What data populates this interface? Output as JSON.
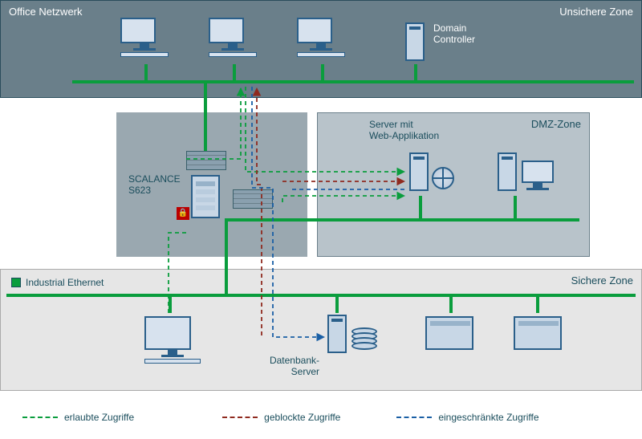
{
  "zones": {
    "unsafe": "Unsichere Zone",
    "office": "Office Netzwerk",
    "dmz": "DMZ-Zone",
    "safe": "Sichere Zone"
  },
  "devices": {
    "domain_controller": "Domain\nController",
    "server_web": "Server mit\nWeb-Applikation",
    "scalance": "SCALANCE\nS623",
    "db_server": "Datenbank-\nServer",
    "industrial_ethernet": "Industrial Ethernet"
  },
  "legend": {
    "allowed": "erlaubte Zugriffe",
    "blocked": "geblockte Zugriffe",
    "restricted": "eingeschränkte Zugriffe"
  },
  "colors": {
    "allowed": "#0a9d3d",
    "blocked": "#8f2a1f",
    "restricted": "#1a5fa5",
    "bus": "#0a9d3d"
  },
  "chart_data": {
    "type": "diagram",
    "nodes": [
      {
        "id": "pc1",
        "type": "pc",
        "zone": "unsafe"
      },
      {
        "id": "pc2",
        "type": "pc",
        "zone": "unsafe"
      },
      {
        "id": "pc3",
        "type": "pc",
        "zone": "unsafe"
      },
      {
        "id": "dc",
        "type": "server",
        "zone": "unsafe",
        "label": "Domain Controller"
      },
      {
        "id": "fw1",
        "type": "firewall",
        "zone": "scalance"
      },
      {
        "id": "fw2",
        "type": "firewall",
        "zone": "scalance"
      },
      {
        "id": "scalance",
        "type": "device",
        "zone": "scalance",
        "label": "SCALANCE S623"
      },
      {
        "id": "webserver",
        "type": "server",
        "zone": "dmz",
        "label": "Server mit Web-Applikation"
      },
      {
        "id": "workstation",
        "type": "workstation",
        "zone": "dmz"
      },
      {
        "id": "pc_safe",
        "type": "pc",
        "zone": "safe"
      },
      {
        "id": "db",
        "type": "server",
        "zone": "safe",
        "label": "Datenbank-Server"
      },
      {
        "id": "plc1",
        "type": "plc",
        "zone": "safe"
      },
      {
        "id": "plc2",
        "type": "plc",
        "zone": "safe"
      }
    ],
    "buses": [
      {
        "zone": "unsafe",
        "type": "industrial-ethernet"
      },
      {
        "zone": "dmz",
        "type": "industrial-ethernet"
      },
      {
        "zone": "safe",
        "type": "industrial-ethernet",
        "label": "Industrial Ethernet"
      }
    ],
    "flows": [
      {
        "from": "unsafe-bus",
        "to": "webserver",
        "via": "scalance",
        "access": "allowed"
      },
      {
        "from": "db",
        "to": "webserver",
        "via": "scalance",
        "access": "allowed"
      },
      {
        "from": "pc_safe",
        "to": "unsafe-bus",
        "via": "scalance",
        "access": "allowed"
      },
      {
        "from": "db",
        "to": "unsafe-bus",
        "via": "scalance",
        "access": "blocked"
      },
      {
        "from": "unsafe-bus",
        "to": "db",
        "via": "scalance",
        "access": "restricted"
      },
      {
        "from": "webserver",
        "to": "db",
        "via": "scalance",
        "access": "restricted"
      }
    ],
    "legend": [
      {
        "key": "allowed",
        "label": "erlaubte Zugriffe",
        "style": "dashed",
        "color": "#0a9d3d"
      },
      {
        "key": "blocked",
        "label": "geblockte Zugriffe",
        "style": "dashed",
        "color": "#8f2a1f"
      },
      {
        "key": "restricted",
        "label": "eingeschränkte Zugriffe",
        "style": "dashed",
        "color": "#1a5fa5"
      }
    ]
  }
}
